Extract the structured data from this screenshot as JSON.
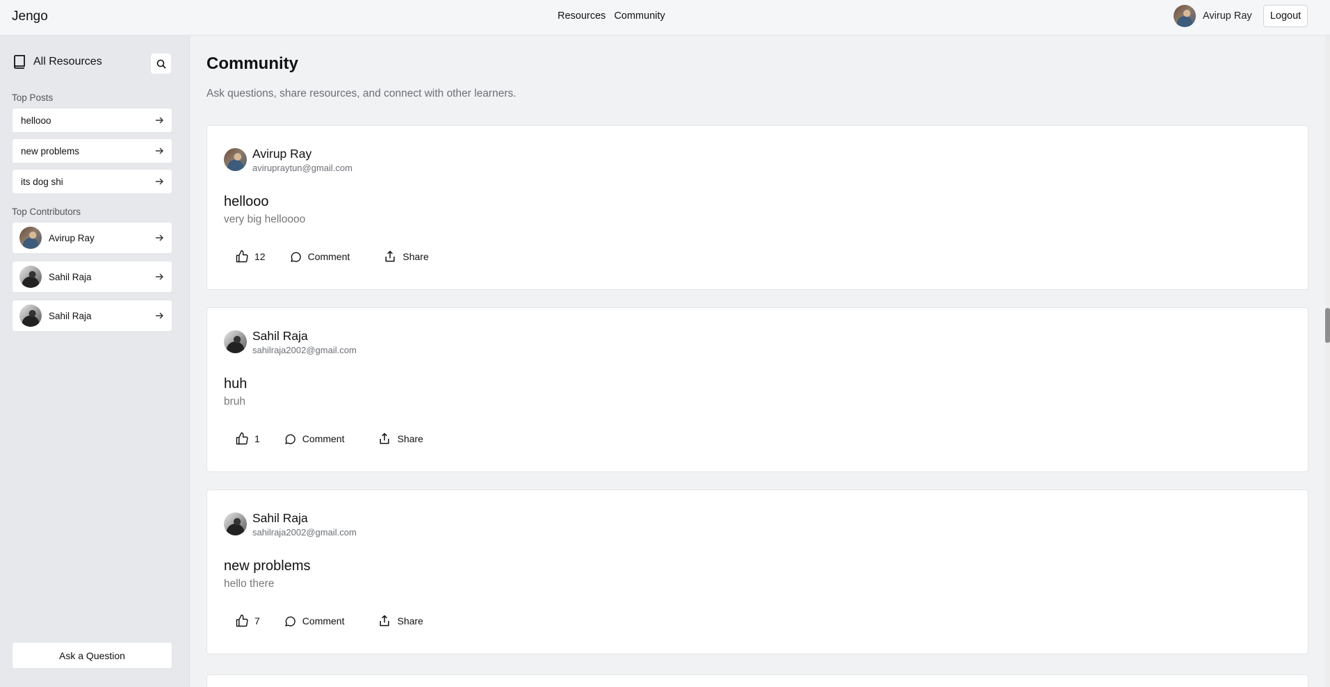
{
  "app": {
    "brand": "Jengo"
  },
  "topnav": {
    "items": [
      "Resources",
      "Community"
    ]
  },
  "user": {
    "name": "Avirup Ray",
    "logout_label": "Logout"
  },
  "sidebar": {
    "header": "All Resources",
    "top_posts_label": "Top Posts",
    "top_posts": [
      "hellooo",
      "new problems",
      "its dog shi"
    ],
    "top_contributors_label": "Top Contributors",
    "top_contributors": [
      "Avirup Ray",
      "Sahil Raja",
      "Sahil Raja"
    ],
    "ask_button": "Ask a Question"
  },
  "main": {
    "title": "Community",
    "subtitle": "Ask questions, share resources, and connect with other learners.",
    "posts": [
      {
        "author": "Avirup Ray",
        "email": "aviruprayt​un@gmail.com",
        "title": "hellooo",
        "body": "very big helloooo",
        "likes": "12",
        "comment_label": "Comment",
        "share_label": "Share"
      },
      {
        "author": "Sahil Raja",
        "email": "sahilraja2002@gmail.com",
        "title": "huh",
        "body": "bruh",
        "likes": "1",
        "comment_label": "Comment",
        "share_label": "Share"
      },
      {
        "author": "Sahil Raja",
        "email": "sahilraja2002@gmail.com",
        "title": "new problems",
        "body": "hello there",
        "likes": "7",
        "comment_label": "Comment",
        "share_label": "Share"
      }
    ]
  },
  "icons": {
    "sidebar_header": "book-icon",
    "search": "search-icon",
    "arrow": "arrow-right-icon",
    "like": "thumbs-up-icon",
    "comment": "comment-icon",
    "share": "share-icon"
  }
}
